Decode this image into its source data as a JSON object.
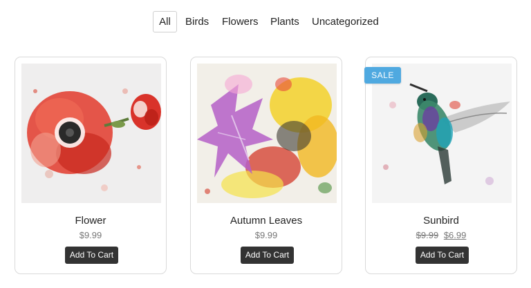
{
  "filters": {
    "active": "All",
    "items": [
      "All",
      "Birds",
      "Flowers",
      "Plants",
      "Uncategorized"
    ]
  },
  "products": [
    {
      "name": "Flower",
      "price": "$9.99",
      "button": "Add To Cart",
      "image": "red-flower-watercolor"
    },
    {
      "name": "Autumn Leaves",
      "price": "$9.99",
      "button": "Add To Cart",
      "image": "autumn-leaves-watercolor"
    },
    {
      "name": "Sunbird",
      "old_price": "$9.99",
      "sale_price": "$6.99",
      "button": "Add To Cart",
      "badge": "SALE",
      "image": "hummingbird-watercolor"
    }
  ],
  "colors": {
    "button_bg": "#333333",
    "sale_badge": "#4fa9e0",
    "card_border": "#d9d9d9"
  }
}
